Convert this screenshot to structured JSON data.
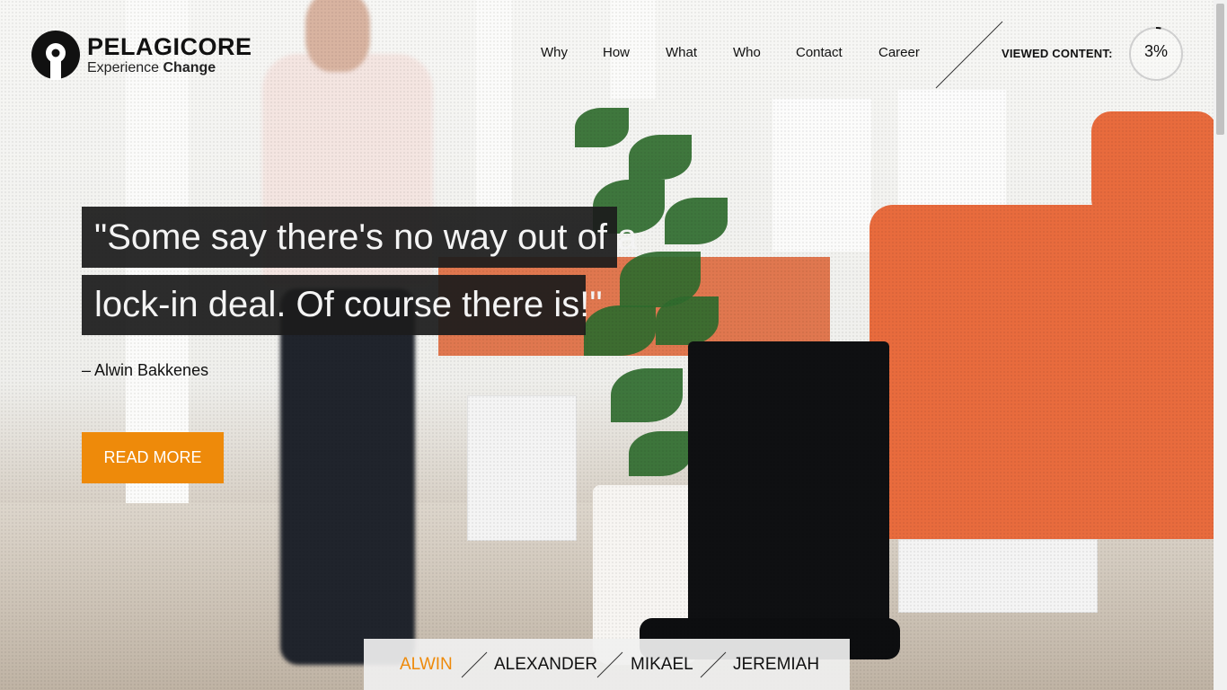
{
  "brand": {
    "name": "PELAGICORE",
    "tagline_plain": "Experience",
    "tagline_bold": "Change",
    "accent_color": "#ee8a0a"
  },
  "nav": {
    "items": [
      {
        "label": "Why"
      },
      {
        "label": "How"
      },
      {
        "label": "What"
      },
      {
        "label": "Who"
      },
      {
        "label": "Contact"
      },
      {
        "label": "Career"
      }
    ]
  },
  "progress": {
    "label": "VIEWED CONTENT:",
    "value_text": "3%",
    "value_fraction": 0.03
  },
  "hero": {
    "quote_line1": "\"Some say there's no way out of a",
    "quote_line2": "lock-in deal. Of course there is!\"",
    "author": "– Alwin Bakkenes",
    "cta_label": "READ MORE"
  },
  "people_tabs": {
    "items": [
      {
        "label": "ALWIN",
        "active": true
      },
      {
        "label": "ALEXANDER",
        "active": false
      },
      {
        "label": "MIKAEL",
        "active": false
      },
      {
        "label": "JEREMIAH",
        "active": false
      }
    ]
  },
  "icons": {
    "logo": "pelagicore-logo-icon",
    "divider": "diagonal-divider-icon"
  }
}
